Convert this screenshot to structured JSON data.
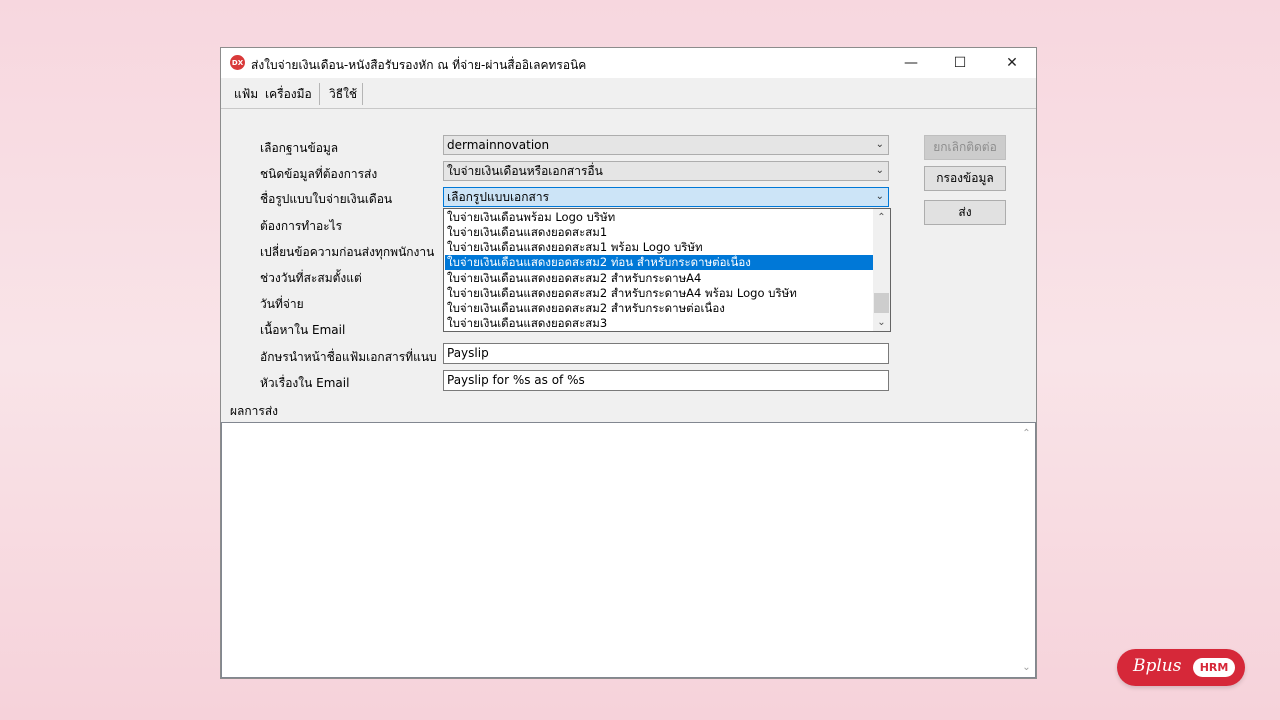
{
  "window": {
    "title": "ส่งใบจ่ายเงินเดือน-หนังสือรับรองหัก ณ ที่จ่าย-ผ่านสื่ออิเลคทรอนิค",
    "icon_text": "DX",
    "minimize": "—",
    "maximize": "☐",
    "close": "✕"
  },
  "menu": {
    "items": [
      "แฟ้ม",
      "เครื่องมือ",
      "วิธีใช้"
    ]
  },
  "form": {
    "labels": {
      "database": "เลือกฐานข้อมูล",
      "data_type": "ชนิดข้อมูลที่ต้องการส่ง",
      "template": "ชื่อรูปแบบใบจ่ายเงินเดือน",
      "action": "ต้องการทำอะไร",
      "change_message": "เปลี่ยนข้อความก่อนส่งทุกพนักงาน",
      "period": "ช่วงวันที่สะสมตั้งแต่",
      "pay_date": "วันที่จ่าย",
      "email_content": "เนื้อหาใน Email",
      "prefix": "อักษรนำหน้าชื่อแฟ้มเอกสารที่แนบ",
      "subject": "หัวเรื่องใน Email"
    },
    "database_value": "dermainnovation",
    "data_type_value": "ใบจ่ายเงินเดือนหรือเอกสารอื่น",
    "template_value": "เลือกรูปแบบเอกสาร",
    "prefix_value": "Payslip",
    "subject_value": "Payslip for %s as of %s"
  },
  "dropdown": {
    "items": [
      "ใบจ่ายเงินเดือนพร้อม Logo บริษัท",
      "ใบจ่ายเงินเดือนแสดงยอดสะสม1",
      "ใบจ่ายเงินเดือนแสดงยอดสะสม1 พร้อม Logo บริษัท",
      "ใบจ่ายเงินเดือนแสดงยอดสะสม2 ท่อน สำหรับกระดาษต่อเนื่อง",
      "ใบจ่ายเงินเดือนแสดงยอดสะสม2 สำหรับกระดาษA4",
      "ใบจ่ายเงินเดือนแสดงยอดสะสม2 สำหรับกระดาษA4 พร้อม Logo บริษัท",
      "ใบจ่ายเงินเดือนแสดงยอดสะสม2 สำหรับกระดาษต่อเนื่อง",
      "ใบจ่ายเงินเดือนแสดงยอดสะสม3"
    ],
    "selected_index": 3
  },
  "buttons": {
    "cancel": "ยกเลิกติดต่อ",
    "filter": "กรองข้อมูล",
    "send": "ส่ง"
  },
  "result": {
    "label": "ผลการส่ง"
  },
  "logo": {
    "brand": "Bplus",
    "badge": "HRM",
    "color": "#d62839"
  },
  "colors": {
    "selection": "#0078d7",
    "focus_fill": "#cce4f7"
  }
}
